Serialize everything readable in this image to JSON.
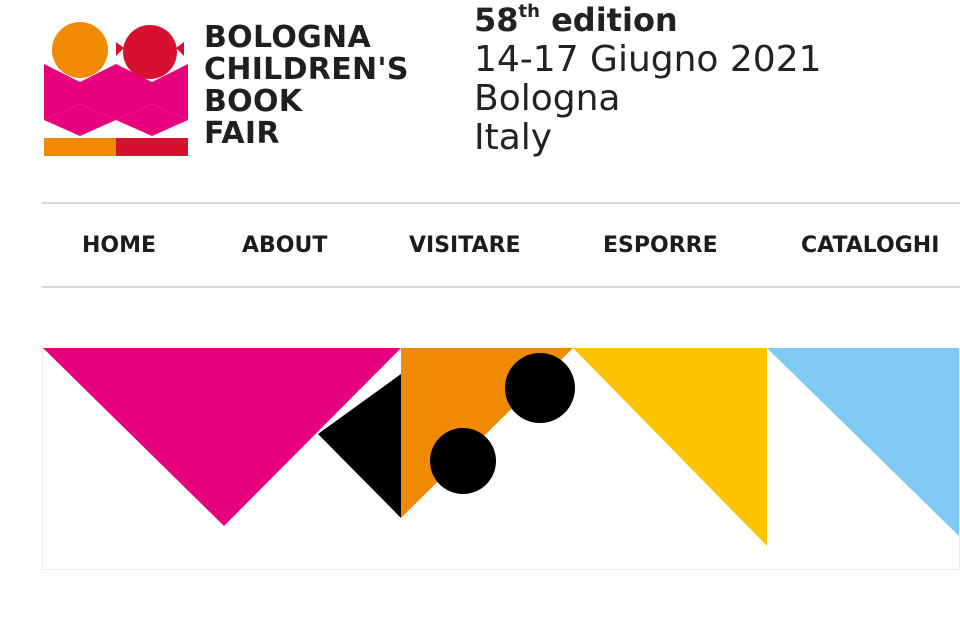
{
  "header": {
    "logo_lines": [
      "BOLOGNA",
      "CHILDREN'S",
      "BOOK",
      "FAIR"
    ],
    "edition_number": "58",
    "edition_suffix": "th",
    "edition_word": "edition",
    "dates": "14-17 Giugno 2021",
    "city": "Bologna",
    "country": "Italy"
  },
  "nav": {
    "items": [
      {
        "label": "HOME"
      },
      {
        "label": "ABOUT"
      },
      {
        "label": "VISITARE"
      },
      {
        "label": "ESPORRE"
      },
      {
        "label": "CATALOGHI"
      }
    ]
  },
  "colors": {
    "magenta": "#e6007e",
    "orange": "#f08a00",
    "red": "#d7102f",
    "black": "#000000",
    "yellow": "#fdc300",
    "light_blue": "#7fcaf2",
    "rule": "#d6d6d6"
  }
}
